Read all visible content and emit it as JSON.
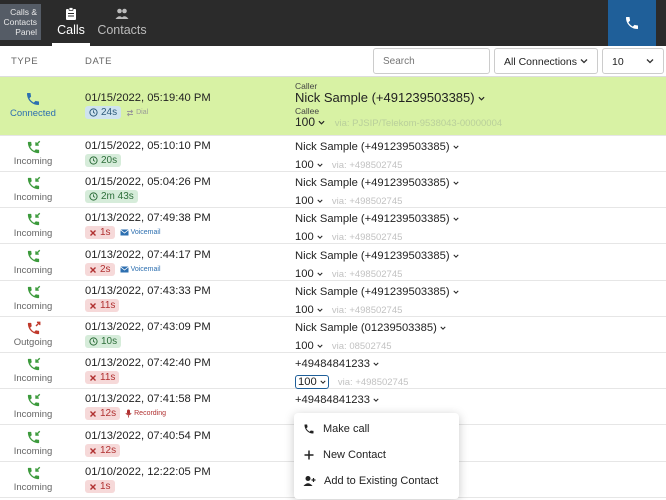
{
  "panel_label": "Calls & Contacts Panel",
  "tabs": [
    {
      "label": "Calls"
    },
    {
      "label": "Contacts"
    }
  ],
  "columns": {
    "type": "TYPE",
    "date": "DATE"
  },
  "search": {
    "placeholder": "Search"
  },
  "connection_filter": {
    "value": "All Connections"
  },
  "page_size": {
    "value": "10"
  },
  "active_call": {
    "type": "Connected",
    "date": "01/15/2022, 05:19:40 PM",
    "duration": "24s",
    "tag": "Dial",
    "caller_label": "Caller",
    "caller": "Nick Sample (+491239503385)",
    "callee_label": "Callee",
    "callee": "100",
    "via": "via: PJSIP/Telekom-9538043-00000004"
  },
  "calls": [
    {
      "type": "Incoming",
      "date": "01/15/2022, 05:10:10 PM",
      "duration": "20s",
      "status": "ok",
      "tag": "",
      "caller": "Nick Sample (+491239503385)",
      "callee": "100",
      "via": "via: +498502745"
    },
    {
      "type": "Incoming",
      "date": "01/15/2022, 05:04:26 PM",
      "duration": "2m 43s",
      "status": "ok",
      "tag": "",
      "caller": "Nick Sample (+491239503385)",
      "callee": "100",
      "via": "via: +498502745"
    },
    {
      "type": "Incoming",
      "date": "01/13/2022, 07:49:38 PM",
      "duration": "1s",
      "status": "bad",
      "tag": "Voicemail",
      "caller": "Nick Sample (+491239503385)",
      "callee": "100",
      "via": "via: +498502745"
    },
    {
      "type": "Incoming",
      "date": "01/13/2022, 07:44:17 PM",
      "duration": "2s",
      "status": "bad",
      "tag": "Voicemail",
      "caller": "Nick Sample (+491239503385)",
      "callee": "100",
      "via": "via: +498502745"
    },
    {
      "type": "Incoming",
      "date": "01/13/2022, 07:43:33 PM",
      "duration": "11s",
      "status": "bad",
      "tag": "",
      "caller": "Nick Sample (+491239503385)",
      "callee": "100",
      "via": "via: +498502745"
    },
    {
      "type": "Outgoing",
      "date": "01/13/2022, 07:43:09 PM",
      "duration": "10s",
      "status": "ok",
      "tag": "",
      "caller": "Nick Sample (01239503385)",
      "callee": "100",
      "via": "via: 08502745"
    },
    {
      "type": "Incoming",
      "date": "01/13/2022, 07:42:40 PM",
      "duration": "11s",
      "status": "bad",
      "tag": "",
      "caller": "+49484841233",
      "callee": "100",
      "via": "via: +498502745"
    },
    {
      "type": "Incoming",
      "date": "01/13/2022, 07:41:58 PM",
      "duration": "12s",
      "status": "bad",
      "tag": "Recording",
      "caller": "+49484841233",
      "callee": "100",
      "via": "via: +498502745"
    },
    {
      "type": "Incoming",
      "date": "01/13/2022, 07:40:54 PM",
      "duration": "12s",
      "status": "bad",
      "tag": "",
      "caller": "",
      "callee": "",
      "via": ""
    },
    {
      "type": "Incoming",
      "date": "01/10/2022, 12:22:05 PM",
      "duration": "1s",
      "status": "bad",
      "tag": "",
      "caller": "",
      "callee": "",
      "via": ""
    }
  ],
  "context_menu": [
    {
      "label": "Make call",
      "icon": "phone-icon"
    },
    {
      "label": "New Contact",
      "icon": "plus-icon"
    },
    {
      "label": "Add to Existing Contact",
      "icon": "add-person-icon"
    }
  ],
  "colors": {
    "topbar": "#2b2b2b",
    "highlight_row": "#d8f2a4",
    "accent_blue": "#1f5f99",
    "incoming_green": "#3c9a3c",
    "outgoing_red": "#c0392b"
  }
}
